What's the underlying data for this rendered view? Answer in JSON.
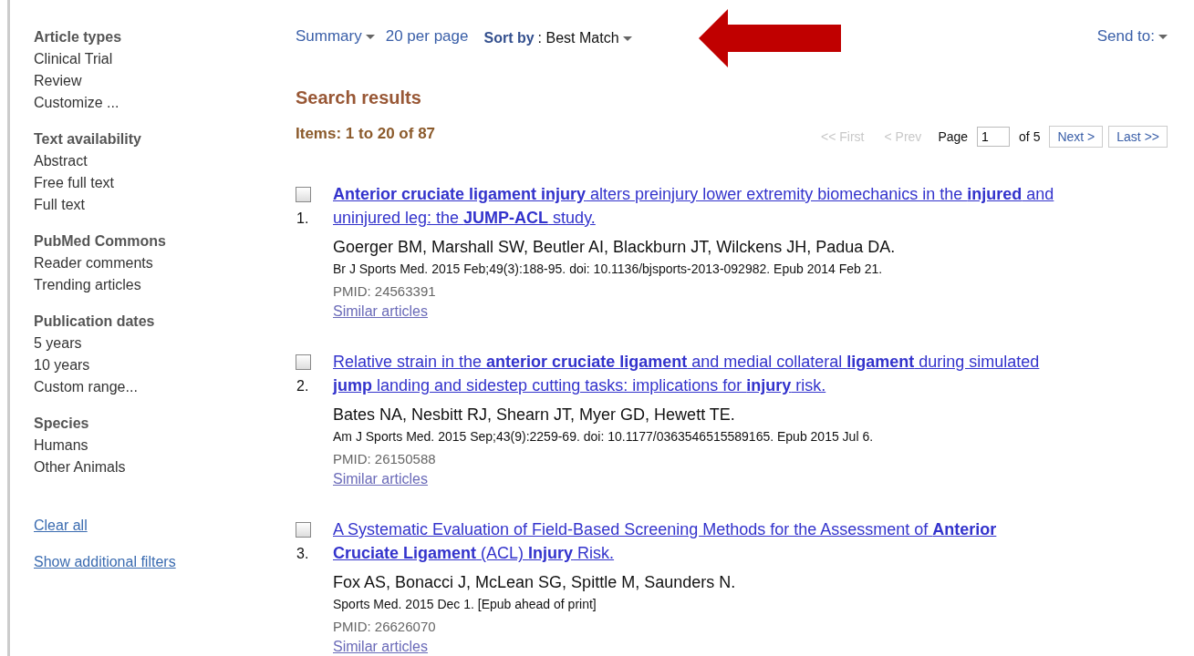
{
  "sidebar": {
    "groups": [
      {
        "heading": "Article types",
        "items": [
          "Clinical Trial",
          "Review",
          "Customize ..."
        ]
      },
      {
        "heading": "Text availability",
        "items": [
          "Abstract",
          "Free full text",
          "Full text"
        ]
      },
      {
        "heading": "PubMed Commons",
        "items": [
          "Reader comments",
          "Trending articles"
        ]
      },
      {
        "heading": "Publication dates",
        "items": [
          "5 years",
          "10 years",
          "Custom range..."
        ]
      },
      {
        "heading": "Species",
        "items": [
          "Humans",
          "Other Animals"
        ]
      }
    ],
    "links": [
      "Clear all",
      "Show additional filters"
    ]
  },
  "toolbar": {
    "format": "Summary",
    "per_page": "20 per page",
    "sort_label": "Sort by",
    "sort_value": ": Best Match",
    "send_to": "Send to:"
  },
  "heading": "Search results",
  "items_count": "Items: 1 to 20 of 87",
  "pager": {
    "first": {
      "label": "<< First",
      "disabled": true
    },
    "prev": {
      "label": "< Prev",
      "disabled": true
    },
    "page_label": "Page",
    "page_value": "1",
    "of": "of 5",
    "next": {
      "label": "Next >",
      "disabled": false
    },
    "last": {
      "label": "Last >>",
      "disabled": false
    }
  },
  "results": [
    {
      "checked": false,
      "number": "1.",
      "title_lines": [
        "**Anterior cruciate ligament injury** alters preinjury lower extremity biomechanics in the **injured** and",
        "uninjured leg: the **JUMP-ACL** study."
      ],
      "authors": "Goerger BM, Marshall SW, Beutler AI, Blackburn JT, Wilckens JH, Padua DA.",
      "citation": "Br J Sports Med. 2015 Feb;49(3):188-95. doi: 10.1136/bjsports-2013-092982. Epub 2014 Feb 21.",
      "pmid": "PMID: 24563391",
      "similar": "Similar articles"
    },
    {
      "checked": false,
      "number": "2.",
      "title_lines": [
        "Relative strain in the **anterior cruciate ligament** and medial collateral **ligament** during simulated",
        "**jump** landing and sidestep cutting tasks: implications for **injury** risk."
      ],
      "authors": "Bates NA, Nesbitt RJ, Shearn JT, Myer GD, Hewett TE.",
      "citation": "Am J Sports Med. 2015 Sep;43(9):2259-69. doi: 10.1177/0363546515589165. Epub 2015 Jul 6.",
      "pmid": "PMID: 26150588",
      "similar": "Similar articles"
    },
    {
      "checked": false,
      "number": "3.",
      "title_lines": [
        "A Systematic Evaluation of Field-Based Screening Methods for the Assessment of **Anterior**",
        "**Cruciate Ligament** (ACL) **Injury** Risk."
      ],
      "authors": "Fox AS, Bonacci J, McLean SG, Spittle M, Saunders N.",
      "citation": "Sports Med. 2015 Dec 1. [Epub ahead of print]",
      "pmid": "PMID: 26626070",
      "similar": "Similar articles"
    }
  ]
}
